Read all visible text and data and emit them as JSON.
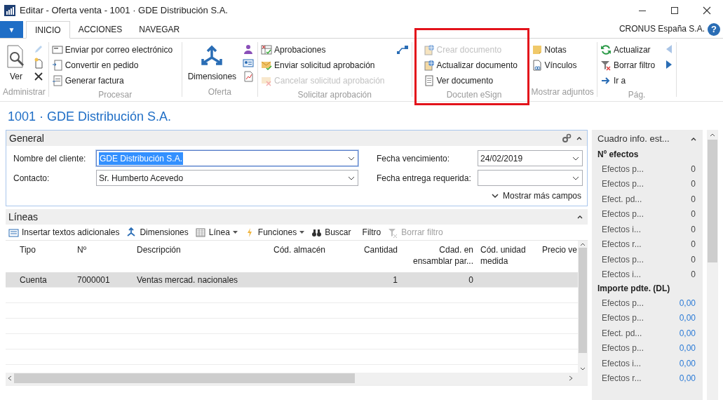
{
  "window": {
    "title": "Editar - Oferta venta - 1001 · GDE Distribución S.A."
  },
  "ribbon": {
    "menu_button": "▼",
    "tabs": [
      {
        "label": "INICIO",
        "selected": true
      },
      {
        "label": "ACCIONES",
        "selected": false
      },
      {
        "label": "NAVEGAR",
        "selected": false
      }
    ],
    "company": "CRONUS España S.A.",
    "help": "?"
  },
  "ribbon_groups": [
    {
      "label": "Administrar",
      "highlighted": false,
      "large": {
        "label": "Ver"
      }
    },
    {
      "label": "Procesar",
      "highlighted": false,
      "actions": [
        {
          "label": "Enviar por correo electrónico",
          "disabled": false
        },
        {
          "label": "Convertir en pedido",
          "disabled": false
        },
        {
          "label": "Generar factura",
          "disabled": false
        }
      ]
    },
    {
      "label": "Oferta",
      "highlighted": false,
      "large": {
        "label": "Dimensiones"
      }
    },
    {
      "label": "Solicitar aprobación",
      "highlighted": false,
      "actions": [
        {
          "label": "Aprobaciones",
          "disabled": false
        },
        {
          "label": "Enviar solicitud aprobación",
          "disabled": false
        },
        {
          "label": "Cancelar solicitud aprobación",
          "disabled": true
        }
      ]
    },
    {
      "label": "Docuten eSign",
      "highlighted": true,
      "actions": [
        {
          "label": "Crear documento",
          "disabled": true
        },
        {
          "label": "Actualizar documento",
          "disabled": false
        },
        {
          "label": "Ver documento",
          "disabled": false
        }
      ]
    },
    {
      "label": "Mostrar adjuntos",
      "highlighted": false,
      "actions": [
        {
          "label": "Notas",
          "disabled": false
        },
        {
          "label": "Vínculos",
          "disabled": false
        }
      ]
    },
    {
      "label": "Pág.",
      "highlighted": false,
      "actions": [
        {
          "label": "Actualizar",
          "disabled": false
        },
        {
          "label": "Borrar filtro",
          "disabled": false
        },
        {
          "label": "Ir a",
          "disabled": false
        }
      ]
    }
  ],
  "page_title": "1001 · GDE Distribución S.A.",
  "general": {
    "title": "General",
    "fields": [
      {
        "label": "Nombre del cliente:",
        "value": "GDE Distribución S.A.",
        "selected": true
      },
      {
        "label": "Contacto:",
        "value": "Sr. Humberto Acevedo",
        "selected": false
      },
      {
        "label": "Fecha vencimiento:",
        "value": "24/02/2019",
        "selected": false
      },
      {
        "label": "Fecha entrega requerida:",
        "selected": false
      }
    ],
    "more_link": "Mostrar más campos"
  },
  "lines": {
    "title": "Líneas",
    "toolbar": [
      {
        "label": "Insertar textos adicionales",
        "disabled": false,
        "dropdown": false
      },
      {
        "label": "Dimensiones",
        "disabled": false,
        "dropdown": false
      },
      {
        "label": "Línea",
        "disabled": false,
        "dropdown": true
      },
      {
        "label": "Funciones",
        "disabled": false,
        "dropdown": true
      },
      {
        "label": "Buscar",
        "disabled": false,
        "dropdown": false
      },
      {
        "label": "Filtro",
        "disabled": false,
        "dropdown": false
      },
      {
        "label": "Borrar filtro",
        "disabled": true,
        "dropdown": false
      }
    ],
    "columns": [
      "Tipo",
      "Nº",
      "Descripción",
      "Cód. almacén",
      "Cantidad",
      "Cdad. en ensamblar par...",
      "Cód. unidad medida",
      "Precio ve"
    ],
    "rows": [
      {
        "cells": [
          "Cuenta",
          "7000001",
          "Ventas mercad. nacionales",
          "",
          "1",
          "0",
          "",
          ""
        ],
        "selected": true
      }
    ]
  },
  "factbox": {
    "title": "Cuadro info. est...",
    "sections": [
      {
        "heading": "Nº efectos",
        "linked": false,
        "rows": [
          {
            "label": "Efectos p...",
            "value": "0"
          },
          {
            "label": "Efectos p...",
            "value": "0"
          },
          {
            "label": "Efect. pd...",
            "value": "0"
          },
          {
            "label": "Efectos p...",
            "value": "0"
          },
          {
            "label": "Efectos i...",
            "value": "0"
          },
          {
            "label": "Efectos r...",
            "value": "0"
          },
          {
            "label": "Efectos p...",
            "value": "0"
          },
          {
            "label": "Efectos i...",
            "value": "0"
          }
        ]
      },
      {
        "heading": "Importe pdte. (DL)",
        "linked": true,
        "rows": [
          {
            "label": "Efectos p...",
            "value": "0,00"
          },
          {
            "label": "Efectos p...",
            "value": "0,00"
          },
          {
            "label": "Efect. pd...",
            "value": "0,00"
          },
          {
            "label": "Efectos p...",
            "value": "0,00"
          },
          {
            "label": "Efectos i...",
            "value": "0,00"
          },
          {
            "label": "Efectos r...",
            "value": "0,00"
          }
        ]
      }
    ]
  }
}
